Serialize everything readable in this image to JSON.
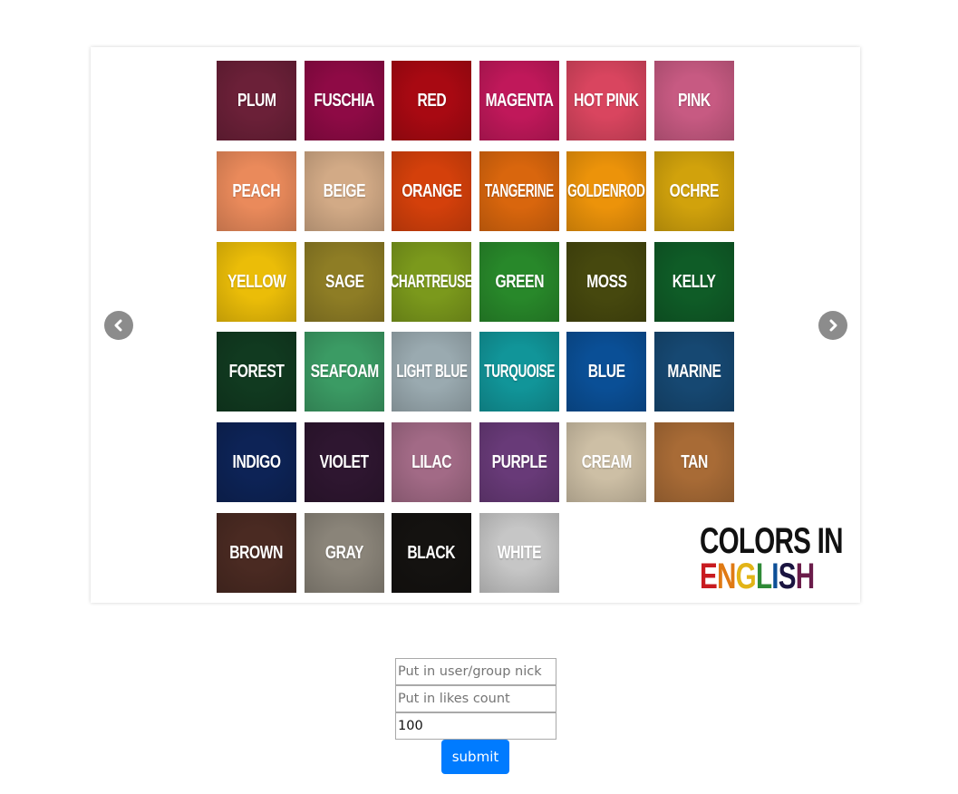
{
  "carousel": {
    "prev_icon": "chevron-left-icon",
    "next_icon": "chevron-right-icon",
    "tiles": [
      {
        "label": "PLUM",
        "color": "#6b2038"
      },
      {
        "label": "FUSCHIA",
        "color": "#8e0a45"
      },
      {
        "label": "RED",
        "color": "#a80912"
      },
      {
        "label": "MAGENTA",
        "color": "#c0185a"
      },
      {
        "label": "HOT PINK",
        "color": "#d9455f"
      },
      {
        "label": "PINK",
        "color": "#c75a82"
      },
      {
        "label": "PEACH",
        "color": "#ea8a5b"
      },
      {
        "label": "BEIGE",
        "color": "#d2aa86"
      },
      {
        "label": "ORANGE",
        "color": "#d4400b"
      },
      {
        "label": "TANGERINE",
        "color": "#d9660d"
      },
      {
        "label": "GOLDENROD",
        "color": "#ec930a"
      },
      {
        "label": "OCHRE",
        "color": "#d1a20c"
      },
      {
        "label": "YELLOW",
        "color": "#ebbd08"
      },
      {
        "label": "SAGE",
        "color": "#8e7d25"
      },
      {
        "label": "CHARTREUSE",
        "color": "#7b991c"
      },
      {
        "label": "GREEN",
        "color": "#28882a"
      },
      {
        "label": "MOSS",
        "color": "#46480e"
      },
      {
        "label": "KELLY",
        "color": "#0f5c27"
      },
      {
        "label": "FOREST",
        "color": "#113a20"
      },
      {
        "label": "SEAFOAM",
        "color": "#3b9b64"
      },
      {
        "label": "LIGHT BLUE",
        "color": "#9aaab0"
      },
      {
        "label": "TURQUOISE",
        "color": "#119599"
      },
      {
        "label": "BLUE",
        "color": "#0a4f96"
      },
      {
        "label": "MARINE",
        "color": "#164872"
      },
      {
        "label": "INDIGO",
        "color": "#0d2356"
      },
      {
        "label": "VIOLET",
        "color": "#2e1630"
      },
      {
        "label": "LILAC",
        "color": "#a26a86"
      },
      {
        "label": "PURPLE",
        "color": "#683a78"
      },
      {
        "label": "CREAM",
        "color": "#cdbfa5"
      },
      {
        "label": "TAN",
        "color": "#a86b36"
      },
      {
        "label": "BROWN",
        "color": "#4a2a22"
      },
      {
        "label": "GRAY",
        "color": "#8a8479"
      },
      {
        "label": "BLACK",
        "color": "#141210"
      },
      {
        "label": "WHITE",
        "color": "#c6c6c6"
      }
    ],
    "logo": {
      "line1": "COLORS IN",
      "line2_letters": [
        {
          "ch": "E",
          "color": "#c81b20"
        },
        {
          "ch": "N",
          "color": "#e07a14"
        },
        {
          "ch": "G",
          "color": "#e2b417"
        },
        {
          "ch": "L",
          "color": "#2f8a37"
        },
        {
          "ch": "I",
          "color": "#0d4f97"
        },
        {
          "ch": "S",
          "color": "#1a1440"
        },
        {
          "ch": "H",
          "color": "#6b1c4a"
        }
      ]
    }
  },
  "form": {
    "nick_placeholder": "Put in user/group nick",
    "likes_placeholder": "Put in likes count",
    "third_value": "100",
    "submit_label": "submit"
  }
}
